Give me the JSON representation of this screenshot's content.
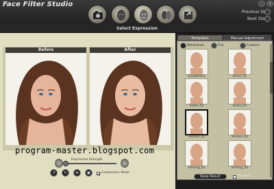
{
  "app": {
    "title": "Face Filter Studio"
  },
  "window": {
    "min_icon": "minimize-icon",
    "close_icon": "close-icon"
  },
  "toolbar": {
    "items": [
      {
        "icon": "camera-icon"
      },
      {
        "icon": "face-gray-icon"
      },
      {
        "icon": "face-expression-icon"
      },
      {
        "icon": "faces-compare-icon"
      },
      {
        "icon": "export-icon"
      }
    ]
  },
  "nav": {
    "previous": "Previous Step",
    "next": "Next Step"
  },
  "step": {
    "label": "Select Expression"
  },
  "panels": {
    "before": "Before",
    "after": "After"
  },
  "watermark": "program-master.blogspot.com",
  "controls": {
    "strength_label": "Expression Strength",
    "strength_value": 0.0,
    "compare_label": "Comparison Mode",
    "compare_checked": true
  },
  "tabs": [
    {
      "label": "Templates"
    },
    {
      "label": "Manual Adjustment"
    }
  ],
  "filters": [
    {
      "label": "Attractive",
      "selected": true
    },
    {
      "label": "Fun",
      "selected": false
    },
    {
      "label": "Custom",
      "selected": false
    }
  ],
  "thumbnails": [
    {
      "label": "Doubleface"
    },
    {
      "label": "Smile_01"
    },
    {
      "label": "Smile_02"
    },
    {
      "label": "Smile_03"
    },
    {
      "label": "Tension_01",
      "selected": true
    },
    {
      "label": "Tension_02"
    },
    {
      "label": "Smiling_01"
    },
    {
      "label": "Smiling_02"
    }
  ],
  "footer": {
    "keep_result": "Keep Result",
    "preview": "Preview"
  },
  "colors": {
    "panel_bg": "#e1dfc2",
    "dark_bg": "#1c1c1c",
    "title_bg": "#3d3c36"
  }
}
